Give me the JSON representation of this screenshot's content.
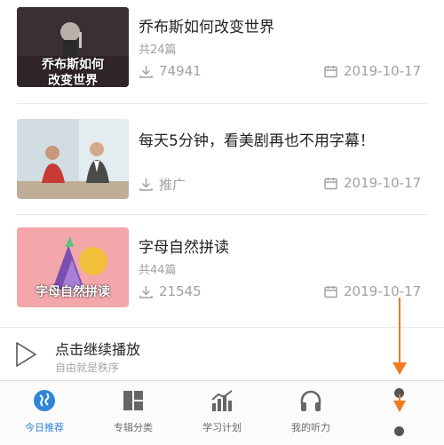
{
  "list": [
    {
      "title": "乔布斯如何改变世界",
      "count": "共24篇",
      "stat": "74941",
      "date": "2019-10-17",
      "thumb_text": [
        "乔布斯如何",
        "改变世界"
      ]
    },
    {
      "title": "每天5分钟，看美剧再也不用字幕！",
      "count": "",
      "stat": "推广",
      "date": "2019-10-17",
      "thumb_text": []
    },
    {
      "title": "字母自然拼读",
      "count": "共44篇",
      "stat": "21545",
      "date": "2019-10-17",
      "thumb_text": [
        "字母自然拼读"
      ]
    }
  ],
  "player": {
    "title": "点击继续播放",
    "subtitle": "自由就是秩序"
  },
  "tabs": [
    {
      "label": "今日推荐",
      "icon": "globe-icon"
    },
    {
      "label": "专辑分类",
      "icon": "grid-icon"
    },
    {
      "label": "学习计划",
      "icon": "chart-icon"
    },
    {
      "label": "我的听力",
      "icon": "headphones-icon"
    }
  ],
  "colors": {
    "accent": "#2f86d6",
    "annotation": "#f27b1e"
  }
}
